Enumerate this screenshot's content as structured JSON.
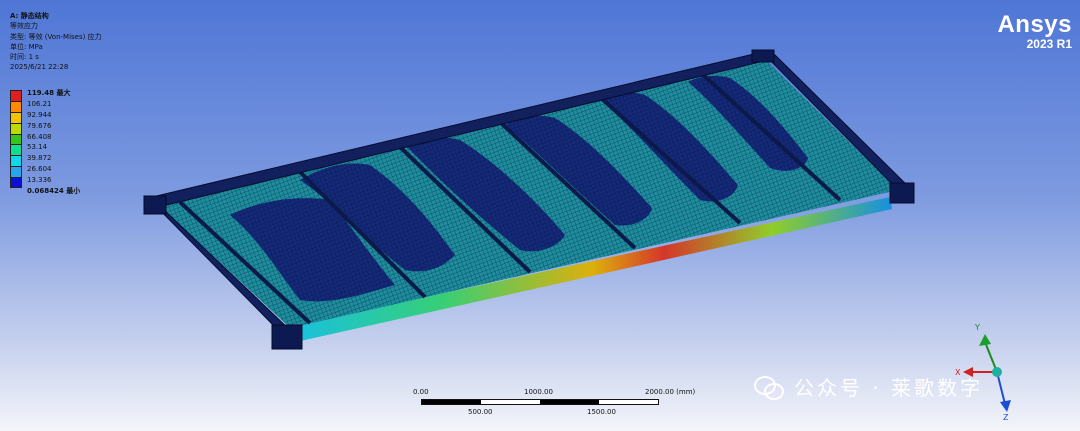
{
  "info": {
    "title": "A: 静态结构",
    "line1": "等效应力",
    "line2": "类型: 等效 (Von-Mises) 应力",
    "line3": "单位: MPa",
    "line4": "时间: 1 s",
    "line5": "2025/6/21 22:28"
  },
  "legend": {
    "labels": [
      "119.48 最大",
      "106.21",
      "92.944",
      "79.676",
      "66.408",
      "53.14",
      "39.872",
      "26.604",
      "13.336",
      "0.068424 最小"
    ],
    "colors": [
      "#e02020",
      "#ff8a00",
      "#f2c400",
      "#bcdc00",
      "#38c420",
      "#10e08e",
      "#13d6e8",
      "#27a6ee",
      "#1060e8",
      "#0a10d8"
    ]
  },
  "logo": {
    "name": "Ansys",
    "version": "2023 R1"
  },
  "scale_bar": {
    "top_labels": [
      "0.00",
      "1000.00",
      "2000.00 (mm)"
    ],
    "bottom_labels": [
      "500.00",
      "1500.00"
    ]
  },
  "triad": {
    "y": "Y",
    "x": "X",
    "z": "Z"
  },
  "watermark": {
    "text": "公众号 · 莱歌数字"
  }
}
